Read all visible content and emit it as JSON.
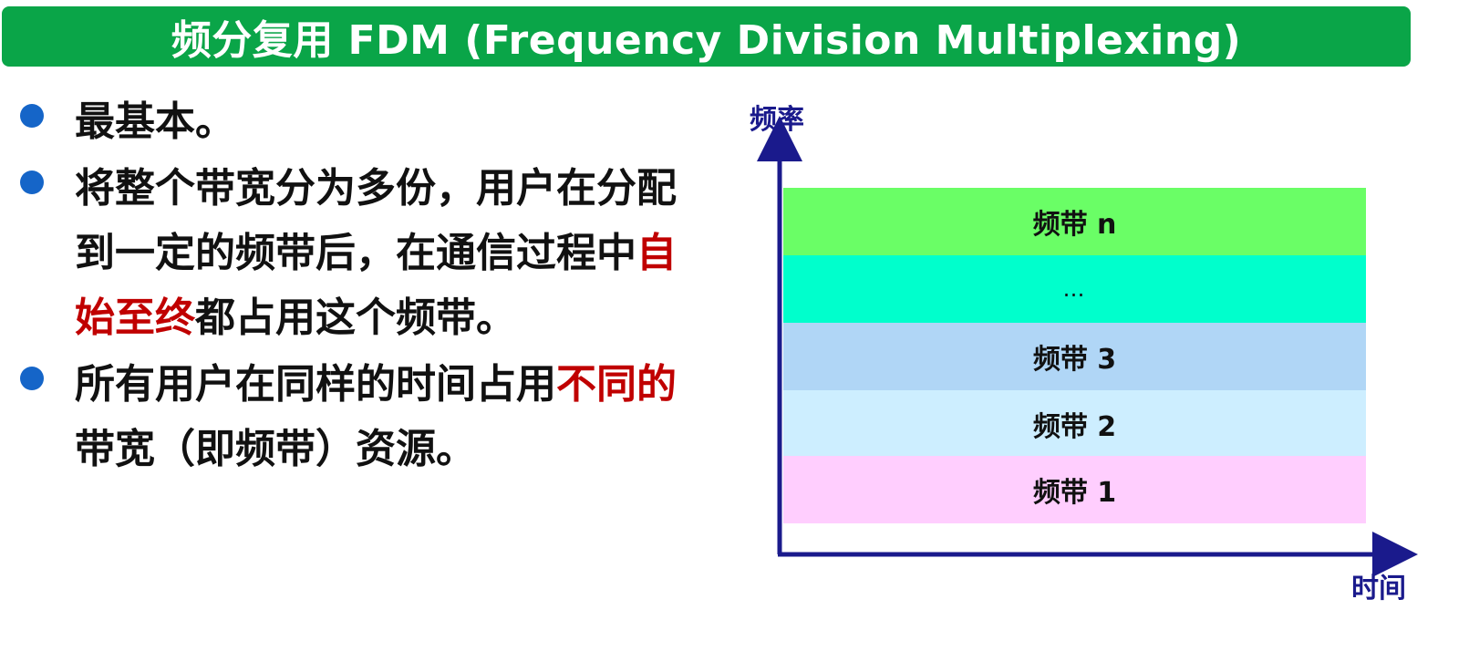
{
  "title": "频分复用 FDM (Frequency Division Multiplexing)",
  "colors": {
    "title_bar": "#0aa548",
    "bullet": "#1565c8",
    "highlight": "#c00000",
    "axis": "#1a1a8c"
  },
  "bullets": [
    {
      "text": "最基本。"
    },
    {
      "text_before": "将整个带宽分为多份，用户在分配到一定的频带后，在通信过程中",
      "highlight": "自始至终",
      "text_after": "都占用这个频带。"
    },
    {
      "text_before": "所有用户在同样的时间占用",
      "highlight": "不同的",
      "text_after": "带宽（即频带）资源。"
    }
  ],
  "diagram": {
    "y_axis_label": "频率",
    "x_axis_label": "时间",
    "bands": [
      {
        "label": "频带 n",
        "color": "#6afe66"
      },
      {
        "label": "…",
        "color": "#00ffcc"
      },
      {
        "label": "频带 3",
        "color": "#b0d6f6"
      },
      {
        "label": "频带 2",
        "color": "#cdeeff"
      },
      {
        "label": "频带 1",
        "color": "#ffcefe"
      }
    ]
  }
}
